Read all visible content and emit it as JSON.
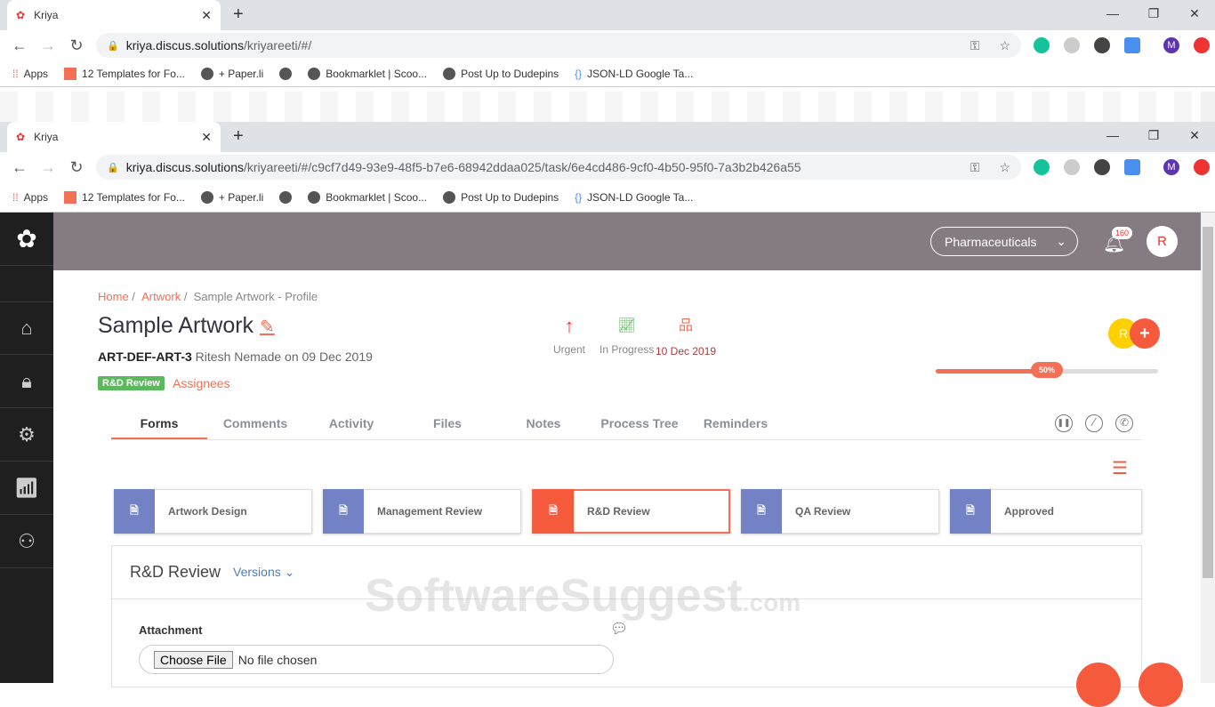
{
  "browser": [
    {
      "tab_title": "Kriya",
      "url_host": "kriya.discus.solutions",
      "url_path": "/kriyareeti/#/"
    },
    {
      "tab_title": "Kriya",
      "url_host": "kriya.discus.solutions",
      "url_path": "/kriyareeti/#/c9cf7d49-93e9-48f5-b7e6-68942ddaa025/task/6e4cd486-9cf0-4b50-95f0-7a3b2b426a55"
    }
  ],
  "bookmarks": [
    "Apps",
    "12 Templates for Fo...",
    "+ Paper.li",
    "",
    "Bookmarklet | Scoo...",
    "Post Up to Dudepins",
    "JSON-LD Google Ta..."
  ],
  "profile_initial": "M",
  "header": {
    "workspace": "Pharmaceuticals",
    "notifications": "160",
    "avatar": "R"
  },
  "breadcrumb": {
    "home": "Home",
    "artwork": "Artwork",
    "current": "Sample Artwork - Profile"
  },
  "task": {
    "title": "Sample Artwork",
    "id": "ART-DEF-ART-3",
    "meta": "Ritesh Nemade on 09 Dec 2019",
    "stage": "R&D Review",
    "assignees": "Assignees"
  },
  "status": {
    "priority": "Urgent",
    "state": "In Progress",
    "due": "10 Dec 2019"
  },
  "assignee_initial": "R",
  "progress": {
    "value": 50,
    "label": "50%"
  },
  "tabs": [
    "Forms",
    "Comments",
    "Activity",
    "Files",
    "Notes",
    "Process Tree",
    "Reminders"
  ],
  "workflow": [
    "Artwork Design",
    "Management Review",
    "R&D Review",
    "QA Review",
    "Approved"
  ],
  "panel": {
    "title": "R&D Review",
    "versions": "Versions",
    "attachment_label": "Attachment",
    "choose_file": "Choose File",
    "no_file": "No file chosen"
  },
  "watermark": {
    "main": "SoftwareSuggest",
    "suffix": ".com"
  },
  "colors": {
    "accent": "#f36f55",
    "topbar": "#857b82",
    "sidebar": "#1f1f1f",
    "card_icon": "#7382c4"
  }
}
